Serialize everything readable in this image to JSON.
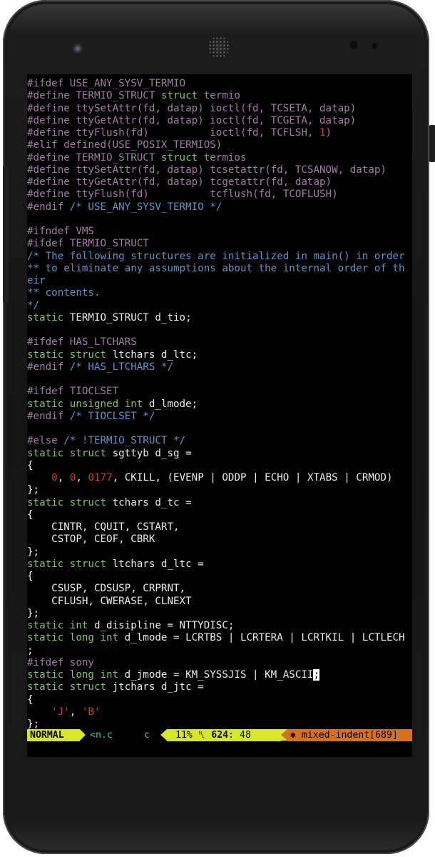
{
  "editor": {
    "lines": [
      [
        [
          "pp",
          "#ifdef USE_ANY_SYSV_TERMIO"
        ]
      ],
      [
        [
          "pp",
          "#define TERMIO_STRUCT "
        ],
        [
          "ty",
          "struct"
        ],
        [
          "pp",
          " termio"
        ]
      ],
      [
        [
          "pp",
          "#define ttySetAttr(fd, datap) ioctl(fd, TCSETA, datap)"
        ]
      ],
      [
        [
          "pp",
          "#define ttyGetAttr(fd, datap) ioctl(fd, TCGETA, datap)"
        ]
      ],
      [
        [
          "pp",
          "#define ttyFlush(fd)          ioctl(fd, TCFLSH, "
        ],
        [
          "nm",
          "1"
        ],
        [
          "pp",
          ")"
        ]
      ],
      [
        [
          "pp",
          "#elif defined(USE_POSIX_TERMIOS)"
        ]
      ],
      [
        [
          "pp",
          "#define TERMIO_STRUCT "
        ],
        [
          "ty",
          "struct"
        ],
        [
          "pp",
          " termios"
        ]
      ],
      [
        [
          "pp",
          "#define ttySetAttr(fd, datap) tcsetattr(fd, TCSANOW, datap)"
        ]
      ],
      [
        [
          "pp",
          "#define ttyGetAttr(fd, datap) tcgetattr(fd, datap)"
        ]
      ],
      [
        [
          "pp",
          "#define ttyFlush(fd)          tcflush(fd, TCOFLUSH)"
        ]
      ],
      [
        [
          "pp",
          "#endif "
        ],
        [
          "cm",
          "/* USE_ANY_SYSV_TERMIO */"
        ]
      ],
      [],
      [
        [
          "pp",
          "#ifndef VMS"
        ]
      ],
      [
        [
          "pp",
          "#ifdef TERMIO_STRUCT"
        ]
      ],
      [
        [
          "cm",
          "/* The following structures are initialized in main() in order"
        ]
      ],
      [
        [
          "cm",
          "** to eliminate any assumptions about the internal order of th"
        ]
      ],
      [
        [
          "cm",
          "eir"
        ]
      ],
      [
        [
          "cm",
          "** contents."
        ]
      ],
      [
        [
          "cm",
          "*/"
        ]
      ],
      [
        [
          "ty",
          "static"
        ],
        [
          "",
          " TERMIO_STRUCT d_tio;"
        ]
      ],
      [],
      [
        [
          "pp",
          "#ifdef HAS_LTCHARS"
        ]
      ],
      [
        [
          "ty",
          "static"
        ],
        [
          "",
          " "
        ],
        [
          "ty",
          "struct"
        ],
        [
          "",
          " ltchars d_ltc;"
        ]
      ],
      [
        [
          "pp",
          "#endif "
        ],
        [
          "cm",
          "/* HAS_LTCHARS */"
        ]
      ],
      [],
      [
        [
          "pp",
          "#ifdef TIOCLSET"
        ]
      ],
      [
        [
          "ty",
          "static"
        ],
        [
          "",
          " "
        ],
        [
          "ty",
          "unsigned"
        ],
        [
          "",
          " "
        ],
        [
          "ty",
          "int"
        ],
        [
          "",
          " d_lmode;"
        ]
      ],
      [
        [
          "pp",
          "#endif "
        ],
        [
          "cm",
          "/* TIOCLSET */"
        ]
      ],
      [],
      [
        [
          "pp",
          "#else "
        ],
        [
          "cm",
          "/* !TERMIO_STRUCT */"
        ]
      ],
      [
        [
          "ty",
          "static"
        ],
        [
          "",
          " "
        ],
        [
          "ty",
          "struct"
        ],
        [
          "",
          " sgttyb d_sg ="
        ]
      ],
      [
        [
          "",
          "{"
        ]
      ],
      [
        [
          "",
          "    "
        ],
        [
          "nm",
          "0"
        ],
        [
          "",
          ", "
        ],
        [
          "nm",
          "0"
        ],
        [
          "",
          ", "
        ],
        [
          "nm",
          "0177"
        ],
        [
          "",
          ", CKILL, (EVENP | ODDP | ECHO | XTABS | CRMOD)"
        ]
      ],
      [
        [
          "",
          "};"
        ]
      ],
      [
        [
          "ty",
          "static"
        ],
        [
          "",
          " "
        ],
        [
          "ty",
          "struct"
        ],
        [
          "",
          " tchars d_tc ="
        ]
      ],
      [
        [
          "",
          "{"
        ]
      ],
      [
        [
          "",
          "    CINTR, CQUIT, CSTART,"
        ]
      ],
      [
        [
          "",
          "    CSTOP, CEOF, CBRK"
        ]
      ],
      [
        [
          "",
          "};"
        ]
      ],
      [
        [
          "ty",
          "static"
        ],
        [
          "",
          " "
        ],
        [
          "ty",
          "struct"
        ],
        [
          "",
          " ltchars d_ltc ="
        ]
      ],
      [
        [
          "",
          "{"
        ]
      ],
      [
        [
          "",
          "    CSUSP, CDSUSP, CRPRNT,"
        ]
      ],
      [
        [
          "",
          "    CFLUSH, CWERASE, CLNEXT"
        ]
      ],
      [
        [
          "",
          "};"
        ]
      ],
      [
        [
          "ty",
          "static"
        ],
        [
          "",
          " "
        ],
        [
          "ty",
          "int"
        ],
        [
          "",
          " d_disipline = NTTYDISC;"
        ]
      ],
      [
        [
          "ty",
          "static"
        ],
        [
          "",
          " "
        ],
        [
          "ty",
          "long"
        ],
        [
          "",
          " "
        ],
        [
          "ty",
          "int"
        ],
        [
          "",
          " d_lmode = LCRTBS | LCRTERA | LCRTKIL | LCTLECH"
        ]
      ],
      [
        [
          "",
          ";"
        ]
      ],
      [
        [
          "pp",
          "#ifdef sony"
        ]
      ],
      [
        [
          "ty",
          "static"
        ],
        [
          "",
          " "
        ],
        [
          "ty",
          "long"
        ],
        [
          "",
          " "
        ],
        [
          "ty",
          "int"
        ],
        [
          "",
          " d_jmode = KM_SYSSJIS | KM_ASCII"
        ],
        [
          "cursor",
          ";"
        ]
      ],
      [
        [
          "ty",
          "static"
        ],
        [
          "",
          " "
        ],
        [
          "ty",
          "struct"
        ],
        [
          "",
          " jtchars d_jtc ="
        ]
      ],
      [
        [
          "",
          "{"
        ]
      ],
      [
        [
          "",
          "    "
        ],
        [
          "str",
          "'J'"
        ],
        [
          "",
          ", "
        ],
        [
          "str",
          "'B'"
        ]
      ],
      [
        [
          "",
          "};"
        ]
      ]
    ]
  },
  "statusline": {
    "mode": "NORMAL",
    "file": "<n.c",
    "filetype": "c",
    "percent": "11%",
    "line_symbol": "␤",
    "line": "624",
    "col": "48",
    "warning_icon": "✱",
    "warning": "mixed-indent[689]"
  }
}
